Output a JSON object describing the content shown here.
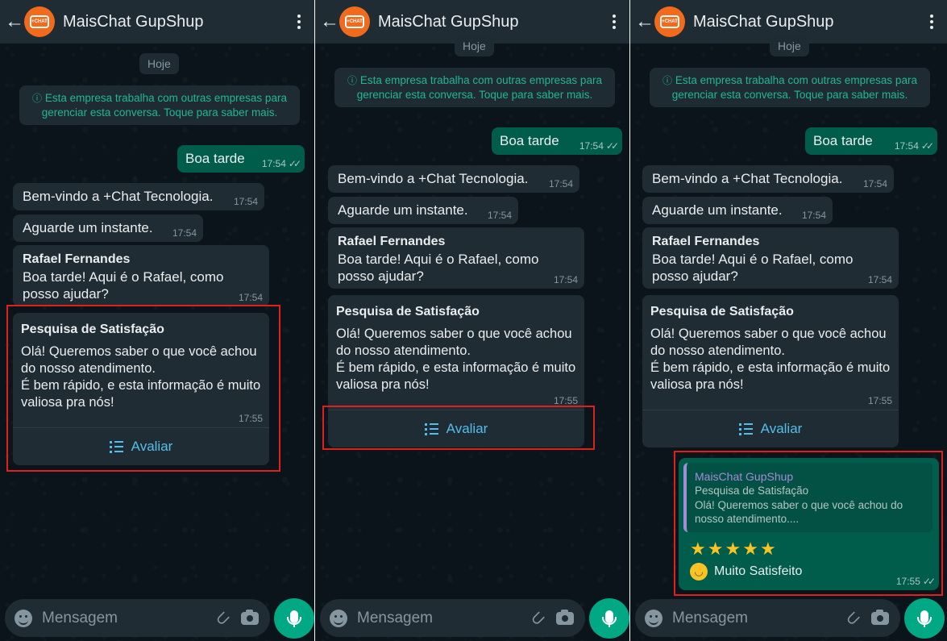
{
  "header": {
    "contact_name": "MaisChat GupShup",
    "avatar_logo_text": "+CHAT"
  },
  "chat": {
    "day_label": "Hoje",
    "notice": "Esta empresa trabalha com outras empresas para gerenciar esta conversa. Toque para saber mais.",
    "notice_icon": "info-icon",
    "outgoing_greeting": "Boa tarde",
    "outgoing_greeting_time": "17:54",
    "welcome": "Bem-vindo a +Chat Tecnologia.",
    "welcome_time": "17:54",
    "wait": "Aguarde um instante.",
    "wait_time": "17:54",
    "agent_name": "Rafael Fernandes",
    "agent_message": "Boa tarde! Aqui é o Rafael, como posso ajudar?",
    "agent_time": "17:54",
    "survey": {
      "title": "Pesquisa de Satisfação",
      "body_line1": "Olá! Queremos saber o que você achou do nosso atendimento.",
      "body_line2": "É bem rápido, e esta informação é muito valiosa pra nós!",
      "time": "17:55",
      "action_label": "Avaliar"
    },
    "reply": {
      "quoted_author": "MaisChat GupShup",
      "quoted_title": "Pesquisa de Satisfação",
      "quoted_body": "Olá! Queremos saber o que você achou do nosso atendimento....",
      "stars_count": 5,
      "rating_label": "Muito Satisfeito",
      "time": "17:55"
    }
  },
  "input": {
    "placeholder": "Mensagem"
  },
  "colors": {
    "header_bg": "#202c33",
    "chat_bg": "#0b141a",
    "incoming_bubble": "#202c33",
    "outgoing_bubble": "#005c4b",
    "accent_green": "#00a884",
    "link_blue": "#53bdeb",
    "highlight_red": "#e0211b",
    "avatar_orange": "#f26b1d"
  }
}
